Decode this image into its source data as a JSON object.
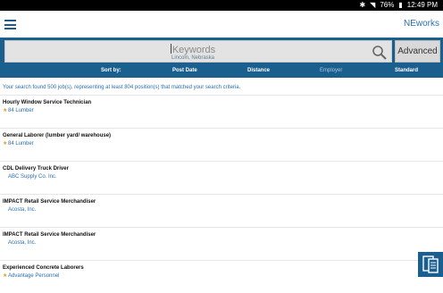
{
  "status_bar": {
    "battery": "76%",
    "time": "12:49 PM"
  },
  "app_bar": {
    "brand": "NEworks"
  },
  "search": {
    "placeholder": "Keywords",
    "location": "Lincoln, Nebraska",
    "advanced_label": "Advanced"
  },
  "sort": {
    "label": "Sort by:",
    "options": [
      "Post Date",
      "Distance",
      "Employer",
      "Standard"
    ],
    "active": "Employer"
  },
  "summary": "Your search found 500 job(s), representing at least 804 position(s) that matched your search criteria.",
  "results": [
    {
      "title": "Hourly Window Service Technician",
      "company": "84 Lumber",
      "starred": true
    },
    {
      "title": "General Laborer (lumber yard/ warehouse)",
      "company": "84 Lumber",
      "starred": true
    },
    {
      "title": "CDL Delivery Truck Driver",
      "company": "ABC Supply Co. Inc.",
      "starred": false
    },
    {
      "title": "IMPACT Retail Service Merchandiser",
      "company": "Acosta, Inc.",
      "starred": false
    },
    {
      "title": "IMPACT Retail Service Merchandiser",
      "company": "Acosta, Inc.",
      "starred": false
    },
    {
      "title": "Experienced Concrete Laborers",
      "company": "Advantage Personnel",
      "starred": true
    }
  ],
  "colors": {
    "primary": "#1b5f8f",
    "link": "#2a6fb0",
    "star": "#e3a21a"
  }
}
